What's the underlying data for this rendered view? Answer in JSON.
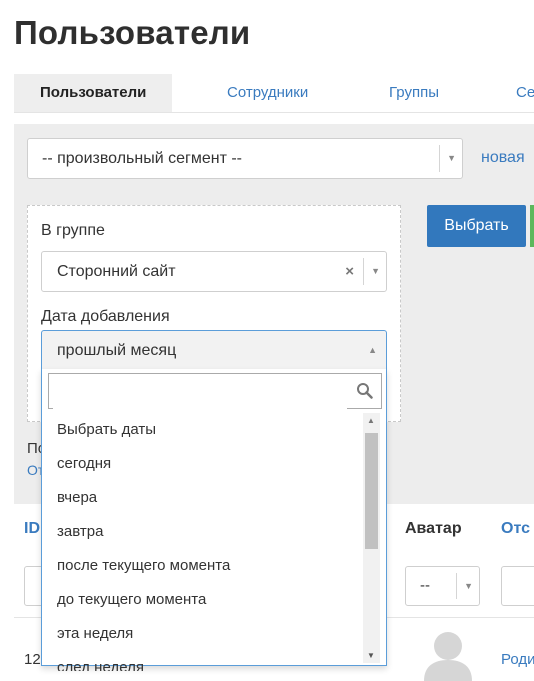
{
  "page": {
    "title": "Пользователи"
  },
  "tabs": [
    {
      "label": "Пользователи",
      "active": true
    },
    {
      "label": "Сотрудники",
      "active": false
    },
    {
      "label": "Группы",
      "active": false
    },
    {
      "label": "Се",
      "active": false
    }
  ],
  "segment": {
    "selected": "-- произвольный сегмент --",
    "new_link": "новая"
  },
  "filter": {
    "group_label": "В группе",
    "group_value": "Сторонний сайт",
    "date_label": "Дата добавления",
    "date_value": "прошлый месяц",
    "apply_button": "Выбрать"
  },
  "dropdown": {
    "search_value": "",
    "options": [
      "Выбрать даты",
      "сегодня",
      "вчера",
      "завтра",
      "после текущего момента",
      "до текущего момента",
      "эта неделя",
      "след неделя"
    ]
  },
  "behind": {
    "text_fragment": "По",
    "link_fragment": "От"
  },
  "table": {
    "headers": {
      "id": "ID",
      "avatar": "Аватар",
      "source": "Отс"
    },
    "avatar_filter_value": "--",
    "row": {
      "id": "12",
      "source": "Роди"
    }
  },
  "colors": {
    "accent": "#3278bd",
    "link": "#3a7bbf",
    "panel": "#ededed",
    "success": "#5cb85c"
  }
}
